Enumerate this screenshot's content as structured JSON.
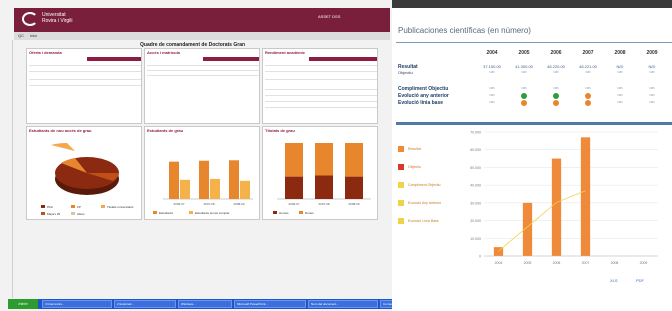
{
  "left": {
    "header": {
      "university_line1": "Universitat",
      "university_line2": "Rovira i Virgili",
      "right_text": "ASSET DSS"
    },
    "breadcrumb": [
      "QC",
      "Inici"
    ],
    "title": "Quadre de comandament de Doctorats Gran",
    "panels": {
      "oferta": {
        "title": "Oferta i demanda"
      },
      "acces": {
        "title": "Accés i matrícula"
      },
      "rendiment": {
        "title": "Rendiment acadèmic"
      },
      "estudiants_acces": {
        "title": "Estudiants de nou accés de grau"
      },
      "estudiants_grau": {
        "title": "Estudiants de grau"
      },
      "titulats": {
        "title": "Títulats de grau"
      }
    },
    "pie_legend": [
      "PAU",
      "FP",
      "Titulats universitaris",
      "Majors 25",
      "Altres"
    ],
    "bar_legend_1": [
      "Estudiants",
      "Estudiants temps complet"
    ],
    "bar_legend_2": [
      "Homes",
      "Dones"
    ],
    "taskbar": {
      "start": "Inicio",
      "items": [
        "3 Internet Ex...",
        "2 Explorad...",
        "Windows...",
        "Microsoft PowerPoint...",
        "Nom del document...",
        "Correu - Mozilla Thun..."
      ]
    },
    "colors": {
      "header": "#7a1f3b",
      "accent_orange": "#e8862d",
      "accent_dark": "#8b2a10",
      "taskbar": "#1f55c8"
    }
  },
  "right": {
    "title": "Publicaciones científicas (en número)",
    "years": [
      "2004",
      "2005",
      "2006",
      "2007",
      "2008",
      "2009"
    ],
    "rows": [
      {
        "label": "Resultat",
        "values": [
          "37.150,00",
          "41.300,00",
          "46.220,00",
          "46.221,00",
          "N/D",
          "N/D"
        ]
      },
      {
        "label": "Objectiu",
        "values": [
          "N/D",
          "N/D",
          "N/D",
          "N/D",
          "N/D",
          "N/D"
        ]
      },
      {
        "label": "Compliment Objectiu",
        "values": [
          "N/D",
          "N/D",
          "N/D",
          "N/D",
          "N/D",
          "N/D"
        ]
      },
      {
        "label": "Evolució any anterior",
        "values": [
          "N/D",
          "",
          "",
          "",
          "N/D",
          "N/D"
        ]
      },
      {
        "label": "Evolució línia base",
        "values": [
          "N/D",
          "",
          "",
          "",
          "N/D",
          "N/D"
        ]
      }
    ],
    "legend": [
      "Resultat",
      "Objectiu",
      "Compliment Objectiu",
      "Evolució Any Anterior",
      "Evolució Línia Base"
    ],
    "footer": [
      "XLS",
      "PDF"
    ],
    "colors": {
      "title": "#5a6a7a",
      "bar": "#ee8a3a",
      "line": "#f2d24a",
      "separator": "#4d7aa6"
    }
  },
  "chart_data": [
    {
      "type": "bar",
      "title": "Publicaciones científicas (en número)",
      "categories": [
        "2004",
        "2005",
        "2006",
        "2007",
        "2008",
        "2009"
      ],
      "series": [
        {
          "name": "Resultat",
          "values": [
            5000,
            30000,
            55000,
            67000,
            null,
            null
          ]
        }
      ],
      "ylim": [
        0,
        70000
      ],
      "yticks": [
        "0",
        "10.000",
        "20.000",
        "30.000",
        "40.000",
        "50.000",
        "60.000",
        "70.000"
      ]
    },
    {
      "type": "bar",
      "title": "Estudiants de grau",
      "categories": [
        "2006-07",
        "2007-08",
        "2008-09"
      ],
      "series": [
        {
          "name": "Estudiants",
          "values": [
            8000,
            8200,
            8300
          ]
        },
        {
          "name": "Estudiants temps complet",
          "values": [
            4100,
            4300,
            3900
          ]
        }
      ],
      "ylim": [
        0,
        12000
      ]
    },
    {
      "type": "bar",
      "title": "Títulats de grau",
      "categories": [
        "2006-07",
        "2007-08",
        "2008-09"
      ],
      "series": [
        {
          "name": "Homes",
          "values": [
            40,
            42,
            40
          ]
        },
        {
          "name": "Dones",
          "values": [
            60,
            58,
            60
          ]
        }
      ],
      "ylim": [
        0,
        100
      ]
    },
    {
      "type": "pie",
      "title": "Estudiants de nou accés de grau",
      "categories": [
        "PAU",
        "FP",
        "Titulats universitaris",
        "Majors 25",
        "Altres"
      ],
      "values": [
        70,
        12,
        8,
        5,
        5
      ]
    }
  ]
}
